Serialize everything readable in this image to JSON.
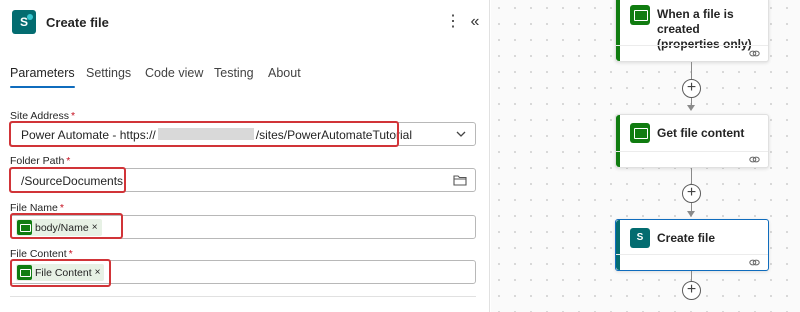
{
  "panel": {
    "title": "Create file",
    "app_icon_letter": "S",
    "more_icon": "⋮",
    "collapse_icon": "«"
  },
  "tabs": [
    {
      "label": "Parameters",
      "active": true
    },
    {
      "label": "Settings"
    },
    {
      "label": "Code view"
    },
    {
      "label": "Testing"
    },
    {
      "label": "About"
    }
  ],
  "fields": {
    "site_address": {
      "label": "Site Address",
      "required_mark": "*",
      "value_prefix": "Power Automate - https://",
      "value_suffix": "/sites/PowerAutomateTutorial"
    },
    "folder_path": {
      "label": "Folder Path",
      "required_mark": "*",
      "value": "/SourceDocuments"
    },
    "file_name": {
      "label": "File Name",
      "required_mark": "*",
      "token_label": "body/Name",
      "token_remove": "×"
    },
    "file_content": {
      "label": "File Content",
      "required_mark": "*",
      "token_label": "File Content",
      "token_remove": "×"
    }
  },
  "flow": {
    "cards": [
      {
        "title_line1": "When a file is created",
        "title_line2": "(properties only)",
        "icon": "sharepoint-trigger-icon"
      },
      {
        "title_line1": "Get file content",
        "icon": "sharepoint-action-icon"
      },
      {
        "title_line1": "Create file",
        "icon": "sharepoint-icon",
        "selected": true
      }
    ],
    "plus_label": "+"
  },
  "colors": {
    "accent": "#0f6cbd",
    "sharepoint_teal": "#036c70",
    "token_green": "#107c10",
    "highlight_red": "#d13438"
  }
}
